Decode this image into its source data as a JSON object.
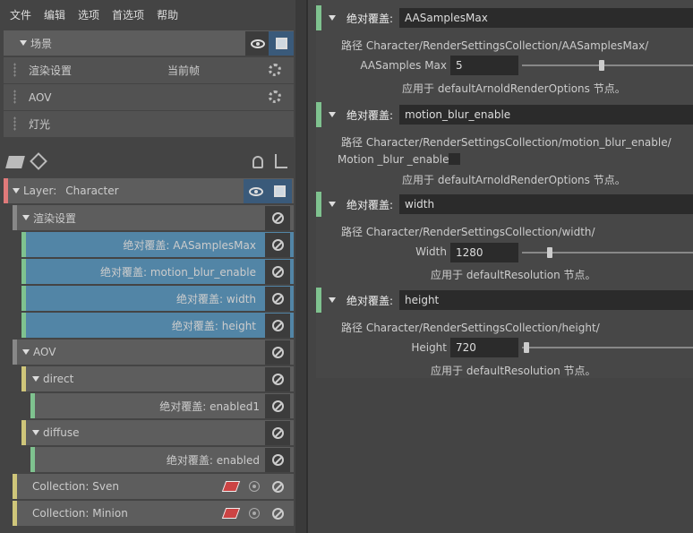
{
  "menu": [
    "文件",
    "编辑",
    "选项",
    "首选项",
    "帮助"
  ],
  "scene": {
    "header": "场景",
    "items": [
      {
        "label": "渲染设置",
        "extra": "当前帧"
      },
      {
        "label": "AOV",
        "extra": ""
      },
      {
        "label": "灯光",
        "extra": ""
      }
    ]
  },
  "tree": {
    "layer_prefix": "Layer:",
    "layer_name": "Character",
    "nodes": [
      {
        "label": "渲染设置"
      },
      {
        "label": "绝对覆盖:",
        "value": "AASamplesMax"
      },
      {
        "label": "绝对覆盖:",
        "value": "motion_blur_enable"
      },
      {
        "label": "绝对覆盖:",
        "value": "width"
      },
      {
        "label": "绝对覆盖:",
        "value": "height"
      },
      {
        "label": "AOV"
      },
      {
        "label": "direct"
      },
      {
        "label": "绝对覆盖:",
        "value": "enabled1"
      },
      {
        "label": "diffuse"
      },
      {
        "label": "绝对覆盖:",
        "value": "enabled"
      },
      {
        "label": "Collection:",
        "value": "Sven"
      },
      {
        "label": "Collection:",
        "value": "Minion"
      }
    ]
  },
  "overrides": [
    {
      "header_label": "绝对覆盖:",
      "name": "AASamplesMax",
      "path": "路径 Character/RenderSettingsCollection/AASamplesMax/",
      "attr_label": "AASamples Max",
      "attr_value": "5",
      "slider_value": 0.45,
      "applies": "应用于 defaultArnoldRenderOptions 节点。"
    },
    {
      "header_label": "绝对覆盖:",
      "name": "motion_blur_enable",
      "path": "路径 Character/RenderSettingsCollection/motion_blur_enable/",
      "attr_label": "Motion _blur _enable",
      "attr_value": "",
      "applies": "应用于 defaultArnoldRenderOptions 节点。"
    },
    {
      "header_label": "绝对覆盖:",
      "name": "width",
      "path": "路径 Character/RenderSettingsCollection/width/",
      "attr_label": "Width",
      "attr_value": "1280",
      "slider_value": 0.15,
      "applies": "应用于 defaultResolution 节点。"
    },
    {
      "header_label": "绝对覆盖:",
      "name": "height",
      "path": "路径 Character/RenderSettingsCollection/height/",
      "attr_label": "Height",
      "attr_value": "720",
      "slider_value": 0.02,
      "applies": "应用于 defaultResolution 节点。"
    }
  ],
  "colors": {
    "render_swatch": "#7fc28f",
    "aov_swatch": "#cfc67a",
    "layer_swatch": "#e07a7a",
    "selected_row": "#5285a6"
  }
}
